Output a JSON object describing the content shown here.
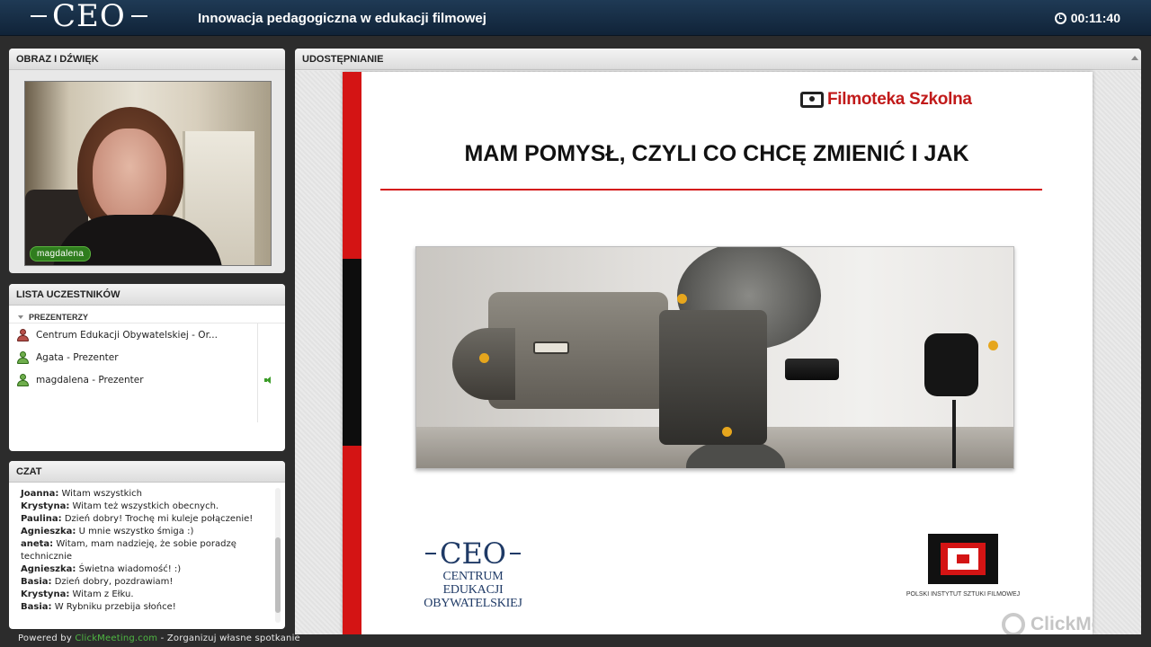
{
  "header": {
    "logo": "CEO",
    "title": "Innowacja pedagogiczna w edukacji filmowej",
    "timer": "00:11:40"
  },
  "video_panel": {
    "title": "OBRAZ I DŹWIĘK",
    "user_name": "magdalena"
  },
  "participants_panel": {
    "title": "LISTA UCZESTNIKÓW",
    "group_label": "PREZENTERZY",
    "items": [
      {
        "label": "Centrum Edukacji Obywatelskiej - Or...",
        "role_color": "red"
      },
      {
        "label": "Agata - Prezenter",
        "role_color": "green"
      },
      {
        "label": "magdalena - Prezenter",
        "role_color": "green",
        "speaking": true
      }
    ]
  },
  "chat_panel": {
    "title": "CZAT",
    "messages": [
      {
        "author": "Joanna:",
        "text": "Witam wszystkich"
      },
      {
        "author": "Krystyna:",
        "text": "Witam też wszystkich obecnych."
      },
      {
        "author": "Paulina:",
        "text": "Dzień dobry! Trochę mi kuleje połączenie!"
      },
      {
        "author": "Agnieszka:",
        "text": "U mnie wszystko śmiga :)"
      },
      {
        "author": "aneta:",
        "text": "Witam, mam nadzieję, że sobie poradzę technicznie"
      },
      {
        "author": "Agnieszka:",
        "text": "Świetna wiadomość! :)"
      },
      {
        "author": "Basia:",
        "text": "Dzień dobry, pozdrawiam!"
      },
      {
        "author": "Krystyna:",
        "text": "Witam z Ełku."
      },
      {
        "author": "Basia:",
        "text": "W Rybniku przebija słońce!"
      }
    ]
  },
  "share_panel": {
    "title": "UDOSTĘPNIANIE",
    "slide": {
      "brand": "Filmoteka Szkolna",
      "title": "MAM POMYSŁ, CZYLI CO CHCĘ ZMIENIĆ I JAK",
      "ceo_mark": "CEO",
      "ceo_line1": "CENTRUM EDUKACJI",
      "ceo_line2": "OBYWATELSKIEJ",
      "pisf": "POLSKI INSTYTUT SZTUKI FILMOWEJ"
    },
    "watermark": "ClickMeeting"
  },
  "footer": {
    "prefix": "Powered by",
    "link": "ClickMeeting.com",
    "suffix": "- Zorganizuj własne spotkanie"
  },
  "colors": {
    "accent_red": "#d41414",
    "brand_blue": "#1f3a66",
    "speaking_green": "#3c9d29"
  }
}
